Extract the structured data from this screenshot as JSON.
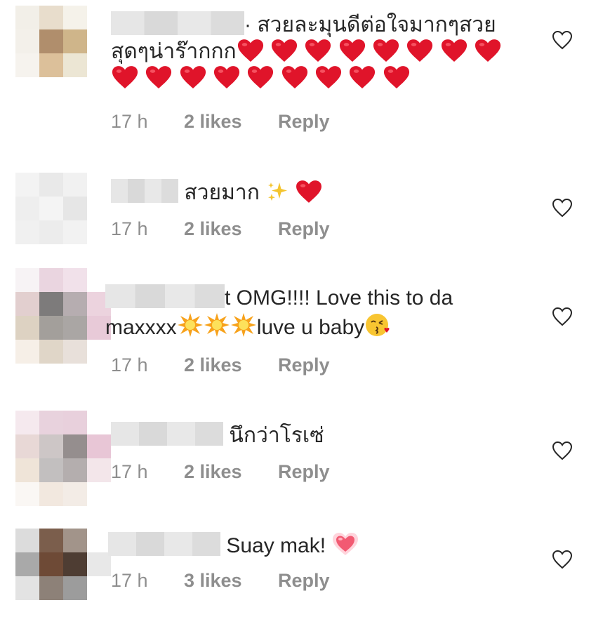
{
  "comments": [
    {
      "text_before": "· สวยละมุนดีต่อใจมากๆสวยสุดๆน่าร๊ากกก",
      "hearts": 17,
      "time": "17 h",
      "likes": "2 likes",
      "reply": "Reply"
    },
    {
      "text_before": "สวยมาก",
      "icons": [
        "sparkles-emoji",
        "red-heart-emoji"
      ],
      "time": "17 h",
      "likes": "2 likes",
      "reply": "Reply"
    },
    {
      "text_before": "t OMG!!!! Love this to da maxxxx",
      "text_after": "luve u baby",
      "icons": [
        "collision-emoji",
        "collision-emoji",
        "collision-emoji",
        "kissing-face-emoji"
      ],
      "time": "17 h",
      "likes": "2 likes",
      "reply": "Reply"
    },
    {
      "text_before": "นึกว่าโรเซ่",
      "time": "17 h",
      "likes": "2 likes",
      "reply": "Reply"
    },
    {
      "text_before": "Suay mak!",
      "icons": [
        "heart-emoji"
      ],
      "time": "17 h",
      "likes": "3 likes",
      "reply": "Reply"
    }
  ],
  "colors": {
    "meta": "#8e8e8e",
    "text": "#262626",
    "heart": "#e0142a"
  }
}
